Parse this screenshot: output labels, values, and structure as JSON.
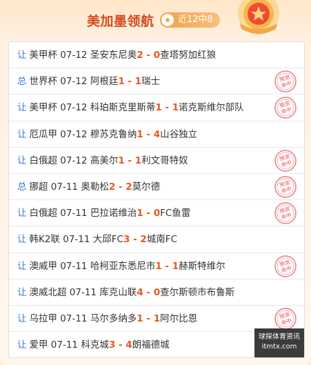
{
  "header": {
    "title": "美加墨领航",
    "record_icon": "star-icon",
    "record": "近12中8"
  },
  "rows": [
    {
      "tag": "让",
      "league": "美甲杯",
      "date": "07-12",
      "home": "圣安东尼奥",
      "hs": "2",
      "as": "0",
      "away": "查塔努加红狼",
      "hit": false
    },
    {
      "tag": "总",
      "league": "世界杯",
      "date": "07-12",
      "home": "阿根廷",
      "hs": "1",
      "as": "1",
      "away": "瑞士",
      "hit": true
    },
    {
      "tag": "让",
      "league": "美甲杯",
      "date": "07-12",
      "home": "科珀斯克里斯蒂",
      "hs": "1",
      "as": "1",
      "away": "诺克斯维尔部队",
      "hit": true
    },
    {
      "tag": "让",
      "league": "厄瓜甲",
      "date": "07-12",
      "home": "穆苏克鲁纳",
      "hs": "1",
      "as": "4",
      "away": "山谷独立",
      "hit": false
    },
    {
      "tag": "让",
      "league": "白俄超",
      "date": "07-12",
      "home": "高美尔",
      "hs": "1",
      "as": "1",
      "away": "利文哥特奴",
      "hit": true
    },
    {
      "tag": "总",
      "league": "挪超",
      "date": "07-11",
      "home": "奥勒松",
      "hs": "2",
      "as": "2",
      "away": "莫尔德",
      "hit": true
    },
    {
      "tag": "让",
      "league": "白俄超",
      "date": "07-11",
      "home": "巴拉诺维治",
      "hs": "1",
      "as": "0",
      "away": "FC鱼雷",
      "hit": true
    },
    {
      "tag": "让",
      "league": "韩K2联",
      "date": "07-11",
      "home": "大邱FC",
      "hs": "3",
      "as": "2",
      "away": "城南FC",
      "hit": false
    },
    {
      "tag": "让",
      "league": "澳威甲",
      "date": "07-11",
      "home": "哈柯亚东悉尼市",
      "hs": "1",
      "as": "1",
      "away": "赫斯特维尔",
      "hit": true
    },
    {
      "tag": "让",
      "league": "澳威北超",
      "date": "07-11",
      "home": "库克山联",
      "hs": "4",
      "as": "0",
      "away": "查尔斯顿市布鲁斯",
      "hit": false
    },
    {
      "tag": "让",
      "league": "乌拉甲",
      "date": "07-11",
      "home": "马尔多纳多",
      "hs": "1",
      "as": "1",
      "away": "阿尔比恩",
      "hit": true
    },
    {
      "tag": "让",
      "league": "爱甲",
      "date": "07-11",
      "home": "科克城",
      "hs": "3",
      "as": "4",
      "away": "朗福德城",
      "hit": false
    }
  ],
  "stamp_text": "预测命中",
  "watermark": {
    "line1": "球探体育资讯",
    "line2": "itmtx.com"
  },
  "colors": {
    "accent": "#e8571f",
    "tag": "#3a7bd5",
    "stamp": "#e0505a"
  }
}
